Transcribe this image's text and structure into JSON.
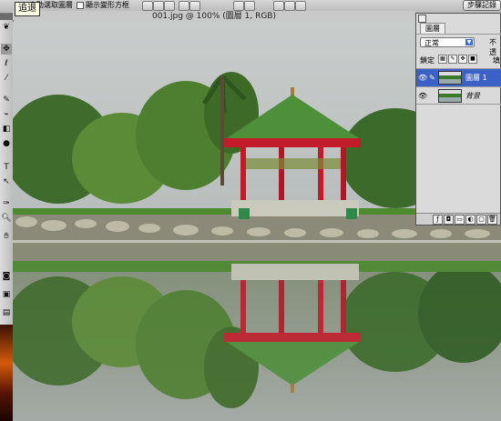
{
  "tooltip": "追退",
  "options_bar": {
    "checkbox_all_layers": "自動選取圖層",
    "checkbox_bounding_box": "顯示變形方框",
    "history_button": "步驟記錄"
  },
  "document": {
    "title": "001.jpg @ 100% (圖層 1, RGB)"
  },
  "layers_panel": {
    "tab_label": "圖層",
    "blend_mode": "正常",
    "opacity_label": "不透",
    "lock_label": "鎖定",
    "fill_label": "填",
    "layers": [
      {
        "name": "圖層 1",
        "active": true,
        "visible": true
      },
      {
        "name": "背景",
        "active": false,
        "visible": true
      }
    ]
  },
  "icons": {
    "eye": "eye-icon",
    "brush": "brush-icon",
    "link": "link-icon",
    "close": "close-icon"
  },
  "colors": {
    "selection_blue": "#3c61c6",
    "panel_gray": "#dadada",
    "pagoda_roof": "#4e8f3a",
    "pagoda_red": "#c21c2a"
  }
}
